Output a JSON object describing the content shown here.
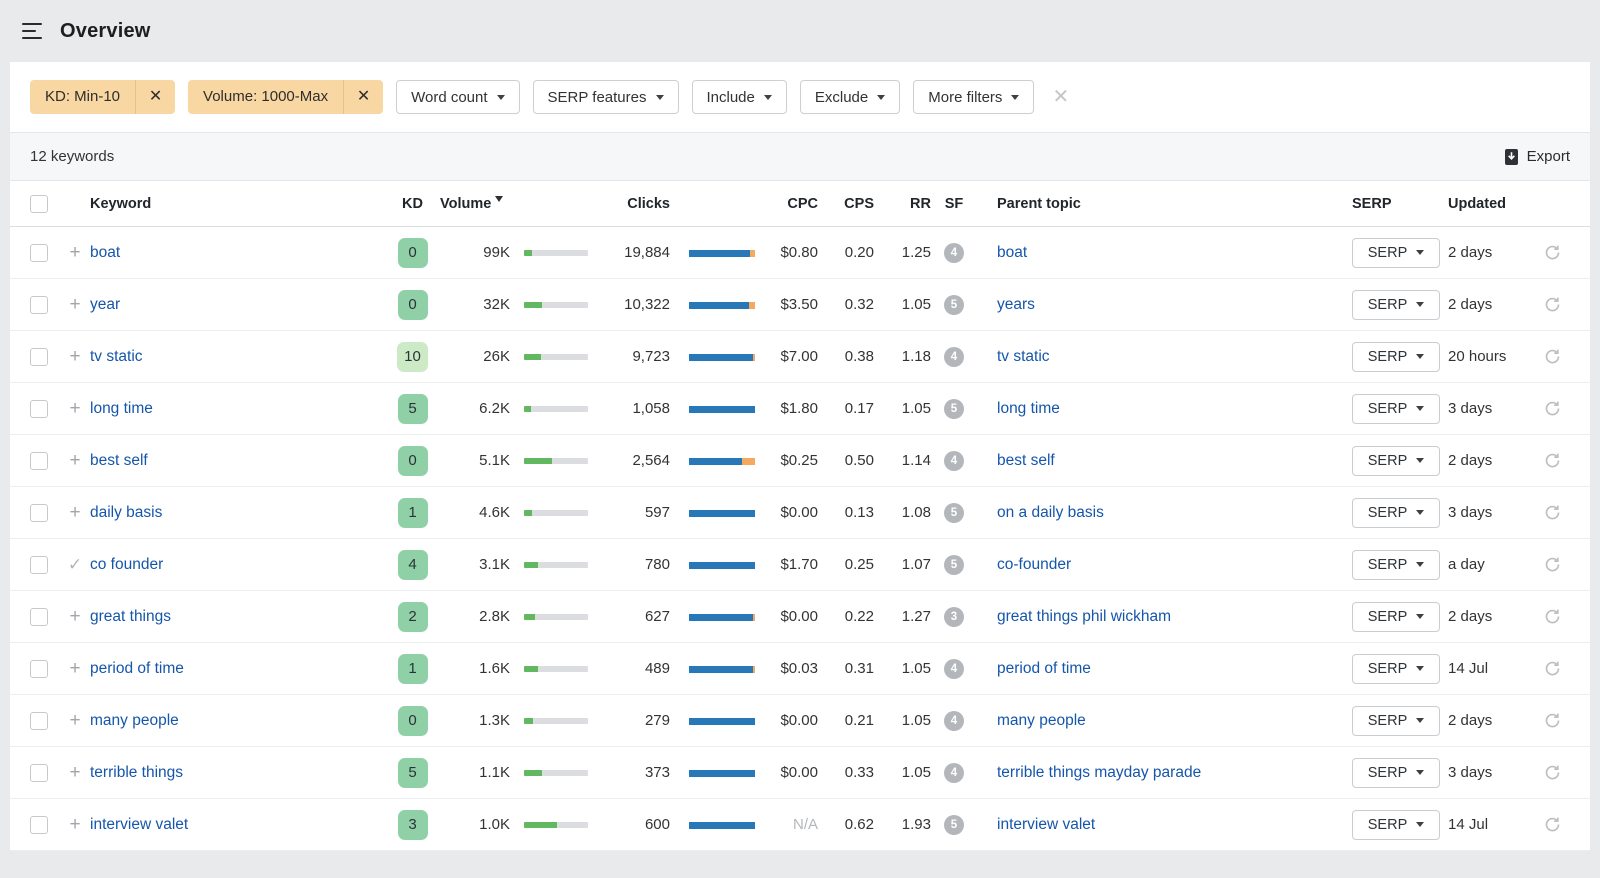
{
  "header": {
    "title": "Overview"
  },
  "filters": {
    "chips": [
      {
        "label": "KD: Min-10"
      },
      {
        "label": "Volume: 1000-Max"
      }
    ],
    "dropdowns": [
      "Word count",
      "SERP features",
      "Include",
      "Exclude",
      "More filters"
    ]
  },
  "toolbar": {
    "count_label": "12 keywords",
    "export_label": "Export"
  },
  "icons": {
    "chip_close": "✕",
    "clear_filters": "✕",
    "plus": "+",
    "check": "✓"
  },
  "colors": {
    "chip_orange": "#f9d7a2",
    "kd_green": "#8fd0a7",
    "kd_light_green": "#cdeac6",
    "volume_bar_green": "#61b861",
    "clicks_bar_blue": "#2878b8",
    "clicks_bar_orange": "#f5a960",
    "link_blue": "#1556ab",
    "sf_badge_gray": "#b3b7bb"
  },
  "table": {
    "columns": [
      "Keyword",
      "KD",
      "Volume",
      "Clicks",
      "CPC",
      "CPS",
      "RR",
      "SF",
      "Parent topic",
      "SERP",
      "Updated"
    ],
    "sorted_column": "Volume",
    "serp_button_label": "SERP",
    "rows": [
      {
        "keyword": "boat",
        "added": false,
        "kd": "0",
        "kd_color": "#8fd0a7",
        "volume": "99K",
        "volume_pct": 12,
        "clicks": "19,884",
        "clicks_blue_pct": 93,
        "clicks_orange_pct": 7,
        "cpc": "$0.80",
        "cpc_na": false,
        "cps": "0.20",
        "rr": "1.25",
        "sf": "4",
        "parent_topic": "boat",
        "updated": "2 days"
      },
      {
        "keyword": "year",
        "added": false,
        "kd": "0",
        "kd_color": "#8fd0a7",
        "volume": "32K",
        "volume_pct": 28,
        "clicks": "10,322",
        "clicks_blue_pct": 91,
        "clicks_orange_pct": 9,
        "cpc": "$3.50",
        "cpc_na": false,
        "cps": "0.32",
        "rr": "1.05",
        "sf": "5",
        "parent_topic": "years",
        "updated": "2 days"
      },
      {
        "keyword": "tv static",
        "added": false,
        "kd": "10",
        "kd_color": "#cdeac6",
        "volume": "26K",
        "volume_pct": 26,
        "clicks": "9,723",
        "clicks_blue_pct": 97,
        "clicks_orange_pct": 3,
        "cpc": "$7.00",
        "cpc_na": false,
        "cps": "0.38",
        "rr": "1.18",
        "sf": "4",
        "parent_topic": "tv static",
        "updated": "20 hours"
      },
      {
        "keyword": "long time",
        "added": false,
        "kd": "5",
        "kd_color": "#8fd0a7",
        "volume": "6.2K",
        "volume_pct": 11,
        "clicks": "1,058",
        "clicks_blue_pct": 100,
        "clicks_orange_pct": 0,
        "cpc": "$1.80",
        "cpc_na": false,
        "cps": "0.17",
        "rr": "1.05",
        "sf": "5",
        "parent_topic": "long time",
        "updated": "3 days"
      },
      {
        "keyword": "best self",
        "added": false,
        "kd": "0",
        "kd_color": "#8fd0a7",
        "volume": "5.1K",
        "volume_pct": 43,
        "clicks": "2,564",
        "clicks_blue_pct": 81,
        "clicks_orange_pct": 19,
        "cpc": "$0.25",
        "cpc_na": false,
        "cps": "0.50",
        "rr": "1.14",
        "sf": "4",
        "parent_topic": "best self",
        "updated": "2 days"
      },
      {
        "keyword": "daily basis",
        "added": false,
        "kd": "1",
        "kd_color": "#8fd0a7",
        "volume": "4.6K",
        "volume_pct": 12,
        "clicks": "597",
        "clicks_blue_pct": 100,
        "clicks_orange_pct": 0,
        "cpc": "$0.00",
        "cpc_na": false,
        "cps": "0.13",
        "rr": "1.08",
        "sf": "5",
        "parent_topic": "on a daily basis",
        "updated": "3 days"
      },
      {
        "keyword": "co founder",
        "added": true,
        "kd": "4",
        "kd_color": "#8fd0a7",
        "volume": "3.1K",
        "volume_pct": 22,
        "clicks": "780",
        "clicks_blue_pct": 100,
        "clicks_orange_pct": 0,
        "cpc": "$1.70",
        "cpc_na": false,
        "cps": "0.25",
        "rr": "1.07",
        "sf": "5",
        "parent_topic": "co-founder",
        "updated": "a day"
      },
      {
        "keyword": "great things",
        "added": false,
        "kd": "2",
        "kd_color": "#8fd0a7",
        "volume": "2.8K",
        "volume_pct": 17,
        "clicks": "627",
        "clicks_blue_pct": 97,
        "clicks_orange_pct": 3,
        "cpc": "$0.00",
        "cpc_na": false,
        "cps": "0.22",
        "rr": "1.27",
        "sf": "3",
        "parent_topic": "great things phil wickham",
        "updated": "2 days"
      },
      {
        "keyword": "period of time",
        "added": false,
        "kd": "1",
        "kd_color": "#8fd0a7",
        "volume": "1.6K",
        "volume_pct": 22,
        "clicks": "489",
        "clicks_blue_pct": 97,
        "clicks_orange_pct": 3,
        "cpc": "$0.03",
        "cpc_na": false,
        "cps": "0.31",
        "rr": "1.05",
        "sf": "4",
        "parent_topic": "period of time",
        "updated": "14 Jul"
      },
      {
        "keyword": "many people",
        "added": false,
        "kd": "0",
        "kd_color": "#8fd0a7",
        "volume": "1.3K",
        "volume_pct": 14,
        "clicks": "279",
        "clicks_blue_pct": 100,
        "clicks_orange_pct": 0,
        "cpc": "$0.00",
        "cpc_na": false,
        "cps": "0.21",
        "rr": "1.05",
        "sf": "4",
        "parent_topic": "many people",
        "updated": "2 days"
      },
      {
        "keyword": "terrible things",
        "added": false,
        "kd": "5",
        "kd_color": "#8fd0a7",
        "volume": "1.1K",
        "volume_pct": 28,
        "clicks": "373",
        "clicks_blue_pct": 100,
        "clicks_orange_pct": 0,
        "cpc": "$0.00",
        "cpc_na": false,
        "cps": "0.33",
        "rr": "1.05",
        "sf": "4",
        "parent_topic": "terrible things mayday parade",
        "updated": "3 days"
      },
      {
        "keyword": "interview valet",
        "added": false,
        "kd": "3",
        "kd_color": "#8fd0a7",
        "volume": "1.0K",
        "volume_pct": 51,
        "clicks": "600",
        "clicks_blue_pct": 100,
        "clicks_orange_pct": 0,
        "cpc": "N/A",
        "cpc_na": true,
        "cps": "0.62",
        "rr": "1.93",
        "sf": "5",
        "parent_topic": "interview valet",
        "updated": "14 Jul"
      }
    ]
  }
}
